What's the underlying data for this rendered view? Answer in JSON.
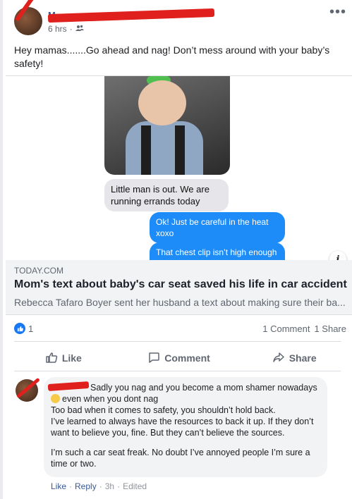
{
  "post": {
    "author_name": "M••••••••••••••••",
    "time": "6 hrs",
    "text": "Hey mamas.......Go ahead and nag! Don’t mess around with your baby’s safety!"
  },
  "chat": {
    "gray_message": "Little man is out. We are running errands today",
    "blue_message_1": "Ok! Just be careful in the heat xoxo",
    "blue_message_2": "That chest clip isn’t high enough or nearly tight enough"
  },
  "link": {
    "domain": "TODAY.COM",
    "headline": "Mom's text about baby's car seat saved his life in car accident",
    "description": "Rebecca Tafaro Boyer sent her husband a text about making sure their ba..."
  },
  "stats": {
    "reactions_count": "1",
    "comments": "1 Comment",
    "shares": "1 Share"
  },
  "actions": {
    "like": "Like",
    "comment": "Comment",
    "share": "Share"
  },
  "comment": {
    "line1": "Sadly you nag and you become a mom shamer nowadays",
    "line2": "even when you dont nag",
    "para1": "Too bad when it comes to safety, you shouldn’t hold back.",
    "para2": "I’ve learned to always have the resources to back it up. If they don’t want to believe you, fine. But they can’t believe the sources.",
    "para3": "I’m such a car seat freak. No doubt I’ve annoyed people I’m sure a time or two.",
    "like": "Like",
    "reply": "Reply",
    "time": "3h",
    "edited": "Edited"
  },
  "colors": {
    "link": "#385898",
    "accent": "#1877f2",
    "redaction": "#e0201c",
    "imessage_blue": "#1d8cf8"
  },
  "icons": [
    "more-icon",
    "audience-friends-icon",
    "info-icon",
    "like-reaction-icon",
    "thumbs-up-icon",
    "comment-icon",
    "share-icon",
    "emoji-icon"
  ]
}
